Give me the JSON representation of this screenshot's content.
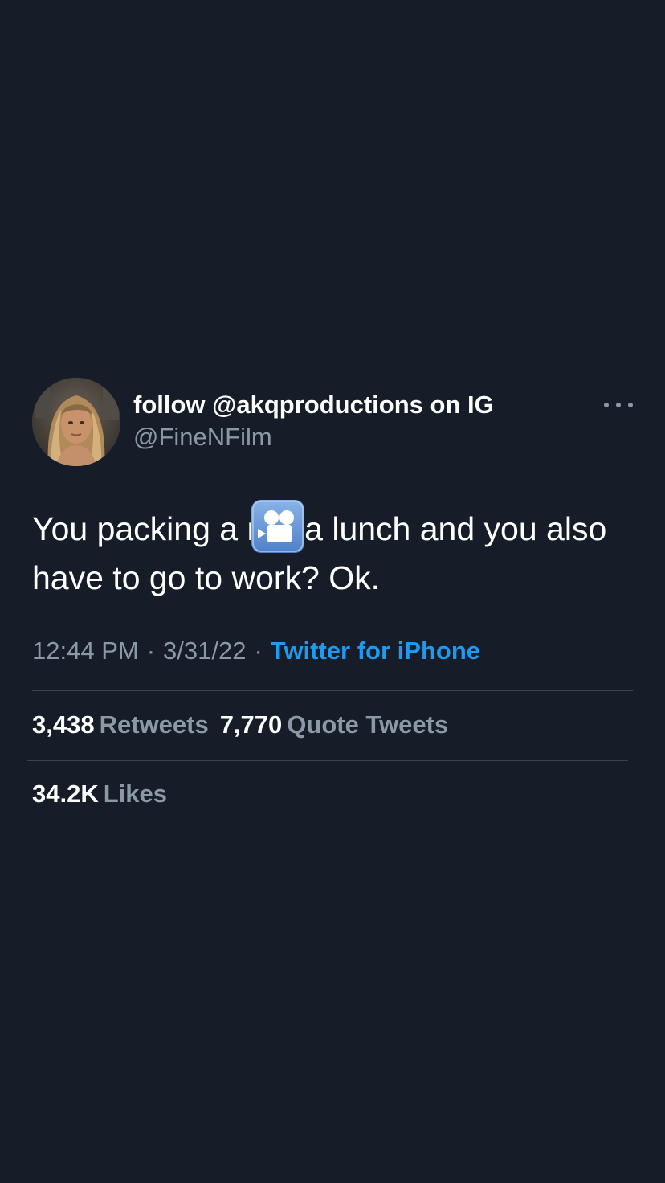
{
  "tweet": {
    "display_name": "follow @akqproductions on IG",
    "handle": "@FineNFilm",
    "text_before": "You packing a r",
    "censor_emoji": "movie-camera-emoji",
    "text_after": "a lunch and you also have to go to work? Ok.",
    "time": "12:44 PM",
    "date": "3/31/22",
    "separator": "·",
    "source": "Twitter for iPhone"
  },
  "stats": {
    "retweets_count": "3,438",
    "retweets_label": "Retweets",
    "quotes_count": "7,770",
    "quotes_label": "Quote Tweets",
    "likes_count": "34.2K",
    "likes_label": "Likes"
  },
  "icons": {
    "more": "more-horizontal-icon",
    "censor": "movie-camera-emoji"
  },
  "colors": {
    "background": "#161d29",
    "primary_text": "#ffffff",
    "secondary_text": "#8b98a5",
    "link": "#1d9bf0",
    "divider": "#38444d"
  }
}
